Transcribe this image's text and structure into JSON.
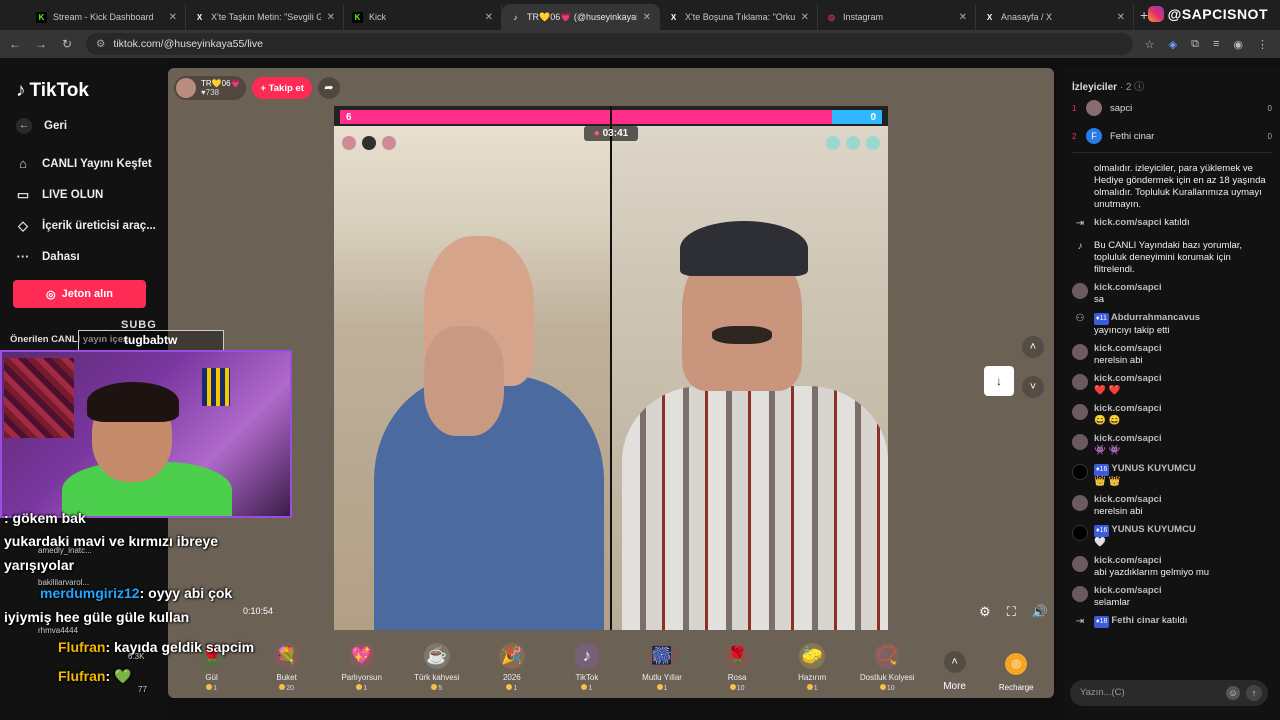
{
  "browser": {
    "tabs": [
      {
        "title": "Stream - Kick Dashboard",
        "icon": "kick-icon",
        "color": "#53fc18"
      },
      {
        "title": "X'te Taşkın Metin: \"Sevgili Galat",
        "icon": "x-icon",
        "color": "#ffffff"
      },
      {
        "title": "Kick",
        "icon": "kick-icon",
        "color": "#53fc18"
      },
      {
        "title": "TR💛06💗 (@huseyinkaya5",
        "icon": "tiktok-icon",
        "color": "#ffffff"
      },
      {
        "title": "X'te Boşuna Tıklama: \"Orkun Iş",
        "icon": "x-icon",
        "color": "#ffffff"
      },
      {
        "title": "Instagram",
        "icon": "instagram-icon",
        "color": "#e1306c"
      },
      {
        "title": "Anasayfa / X",
        "icon": "x-icon",
        "color": "#ffffff"
      }
    ],
    "url": "tiktok.com/@huseyinkaya55/live",
    "brand": "@SAPCISNOT"
  },
  "sidebar": {
    "logo": "TikTok",
    "back": "Geri",
    "items": [
      {
        "label": "CANLI Yayını Keşfet",
        "icon": "broadcast-icon"
      },
      {
        "label": "LIVE OLUN",
        "icon": "camera-icon"
      },
      {
        "label": "İçerik üreticisi araç...",
        "icon": "lightbulb-icon"
      },
      {
        "label": "Dahası",
        "icon": "more-icon"
      }
    ],
    "jeton": "Jeton alın",
    "recommended": "Önerilen CANLI yayın içer..."
  },
  "stage": {
    "host_name": "TR💛06💗",
    "host_likes": "738",
    "follow": "+ Takip et",
    "score_left": "6",
    "score_right": "0",
    "timer": "03:41",
    "gifts": [
      {
        "name": "Gül",
        "price": "1",
        "icon": "🌹",
        "color": "#3a7d2e"
      },
      {
        "name": "Buket",
        "price": "20",
        "icon": "💐",
        "color": "#c24f7a"
      },
      {
        "name": "Parlıyorsun",
        "price": "1",
        "icon": "💖",
        "color": "#e2447a"
      },
      {
        "name": "Türk kahvesi",
        "price": "5",
        "icon": "☕",
        "color": "#d8d2c5"
      },
      {
        "name": "2026",
        "price": "1",
        "icon": "🎉",
        "color": "#e89a3a"
      },
      {
        "name": "TikTok",
        "price": "1",
        "icon": "♪",
        "color": "#a55bff"
      },
      {
        "name": "Mutlu Yıllar",
        "price": "1",
        "icon": "🎆",
        "color": "#d62d5e"
      },
      {
        "name": "Rosa",
        "price": "10",
        "icon": "🌹",
        "color": "#d63a3a"
      },
      {
        "name": "Hazırım",
        "price": "1",
        "icon": "🧽",
        "color": "#f2d33b"
      },
      {
        "name": "Dostluk Kolyesi",
        "price": "10",
        "icon": "📿",
        "color": "#c76a8a"
      }
    ],
    "more": "More",
    "recharge": "Recharge"
  },
  "chat": {
    "title": "İzleyiciler",
    "viewer_count": "2",
    "viewers": [
      {
        "rank": "1",
        "name": "sapci",
        "count": "0"
      },
      {
        "rank": "2",
        "name": "Fethi cinar",
        "count": "0"
      }
    ],
    "messages": [
      {
        "user": "",
        "text": "olmalıdır. izleyiciler, para yüklemek ve Hediye göndermek için en az 18 yaşında olmalıdır. Topluluk Kurallarımıza uymayı unutmayın.",
        "avatar": "none"
      },
      {
        "user": "kick.com/sapci",
        "text": "katıldı",
        "avatar": "join",
        "inline": true
      },
      {
        "user": "",
        "text": "Bu CANLI Yayındaki bazı yorumlar, topluluk deneyimini korumak için filtrelendi.",
        "avatar": "tiktok"
      },
      {
        "user": "kick.com/sapci",
        "text": "sa",
        "avatar": "user"
      },
      {
        "user": "Abdurrahmancavus",
        "badge": "11",
        "text": "yayıncıyı takip etti",
        "avatar": "follow"
      },
      {
        "user": "kick.com/sapci",
        "text": "nerelsin abi",
        "avatar": "user"
      },
      {
        "user": "kick.com/sapci",
        "text": "❤️ ❤️",
        "avatar": "user"
      },
      {
        "user": "kick.com/sapci",
        "text": "😄 😄",
        "avatar": "user"
      },
      {
        "user": "kick.com/sapci",
        "text": "👾 👾",
        "avatar": "user"
      },
      {
        "user": "YUNUS KUYUMCU",
        "badge": "16",
        "text": "👑 👑",
        "avatar": "dark"
      },
      {
        "user": "kick.com/sapci",
        "text": "nerelsin abi",
        "avatar": "user"
      },
      {
        "user": "YUNUS KUYUMCU",
        "badge": "16",
        "text": "🤍",
        "avatar": "dark"
      },
      {
        "user": "kick.com/sapci",
        "text": "abi yazdıklarım gelmiyo mu",
        "avatar": "user"
      },
      {
        "user": "kick.com/sapci",
        "text": "selamlar",
        "avatar": "user"
      },
      {
        "user": "Fethi cinar",
        "badge": "18",
        "text": "katıldı",
        "avatar": "join",
        "inline": true
      }
    ],
    "input_placeholder": "Yazın...(C)"
  },
  "overlay": {
    "subg_title": "SUBG",
    "subg_name": "tugbabtw",
    "lines": [
      {
        "user": "",
        "text": ": gökem bak"
      },
      {
        "user": "",
        "text": "yukardaki mavi ve kırmızı ibreye"
      },
      {
        "user": "",
        "text": "yarışıyolar"
      },
      {
        "user": "merdumgiriz12",
        "text": ": oyyy abi çok"
      },
      {
        "user": "",
        "text": "iyiymiş hee güle güle kullan"
      },
      {
        "user": "Flufran",
        "text": ": kayıda geldik sapcim"
      },
      {
        "user": "Flufran",
        "text": ": 💚"
      }
    ],
    "small": [
      "amedly_inatc...",
      "bakililarvarol...",
      "rhmva4444",
      "6.3K",
      "77"
    ],
    "video_time": "0:10:54"
  }
}
